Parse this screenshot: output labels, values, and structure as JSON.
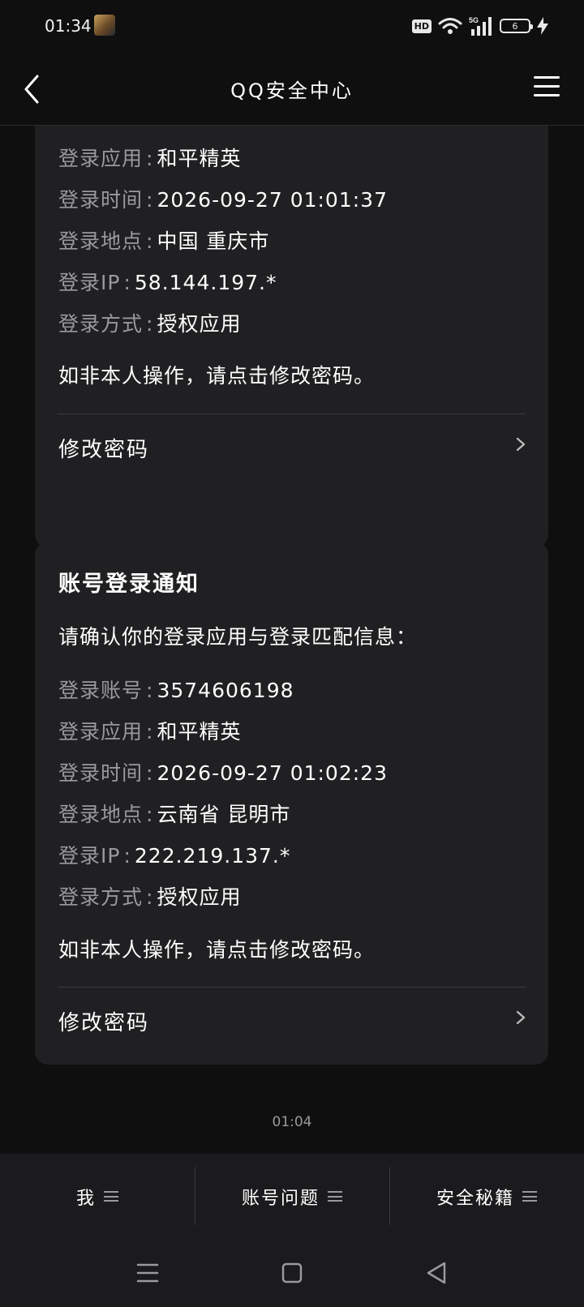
{
  "status_bar": {
    "time": "01:34",
    "hd": "HD",
    "network": "5G",
    "battery": "6"
  },
  "nav": {
    "title": "QQ安全中心"
  },
  "card1": {
    "rows": [
      {
        "label": "登录应用",
        "value": "和平精英"
      },
      {
        "label": "登录时间",
        "value": "2026-09-27 01:01:37"
      },
      {
        "label": "登录地点",
        "value": "中国 重庆市"
      },
      {
        "label": "登录IP",
        "value": "58.144.197.*"
      },
      {
        "label": "登录方式",
        "value": "授权应用"
      }
    ],
    "notice": "如非本人操作，请点击修改密码。",
    "action": "修改密码"
  },
  "card2": {
    "title": "账号登录通知",
    "intro": "请确认你的登录应用与登录匹配信息：",
    "rows": [
      {
        "label": "登录账号",
        "value": "3574606198"
      },
      {
        "label": "登录应用",
        "value": "和平精英"
      },
      {
        "label": "登录时间",
        "value": "2026-09-27 01:02:23"
      },
      {
        "label": "登录地点",
        "value": "云南省 昆明市"
      },
      {
        "label": "登录IP",
        "value": "222.219.137.*"
      },
      {
        "label": "登录方式",
        "value": "授权应用"
      }
    ],
    "notice": "如非本人操作，请点击修改密码。",
    "action": "修改密码"
  },
  "separator": ":",
  "timestamp": "01:04",
  "tabs": [
    {
      "label": "我"
    },
    {
      "label": "账号问题"
    },
    {
      "label": "安全秘籍"
    }
  ]
}
